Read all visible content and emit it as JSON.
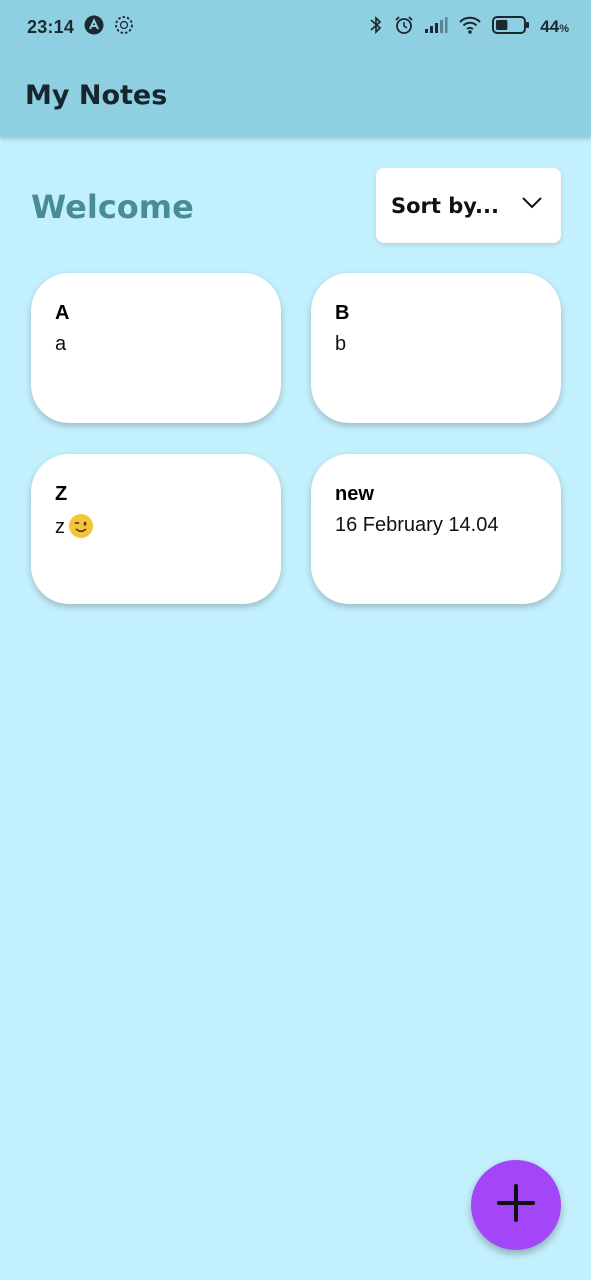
{
  "status_bar": {
    "time": "23:14",
    "battery_percent": "44",
    "battery_unit": "%",
    "battery_level": 0.44,
    "icons": [
      "app-a-icon",
      "sync-icon",
      "bluetooth-icon",
      "alarm-icon",
      "signal-icon",
      "wifi-icon",
      "battery-icon"
    ]
  },
  "app_bar": {
    "title": "My Notes"
  },
  "main": {
    "welcome": "Welcome",
    "sort": {
      "label": "Sort by...",
      "icon": "chevron-down-icon"
    }
  },
  "notes": [
    {
      "title": "A",
      "body": "a"
    },
    {
      "title": "B",
      "body": "b"
    },
    {
      "title": "Z",
      "body": "z",
      "emoji": "winking-face-icon"
    },
    {
      "title": "new",
      "body": "16 February 14.04"
    }
  ],
  "fab": {
    "icon": "plus-icon"
  },
  "colors": {
    "background": "#c3f0fd",
    "header": "#8fcfe2",
    "welcome_text": "#4a8b98",
    "fab": "#a346f7",
    "card": "#ffffff"
  }
}
